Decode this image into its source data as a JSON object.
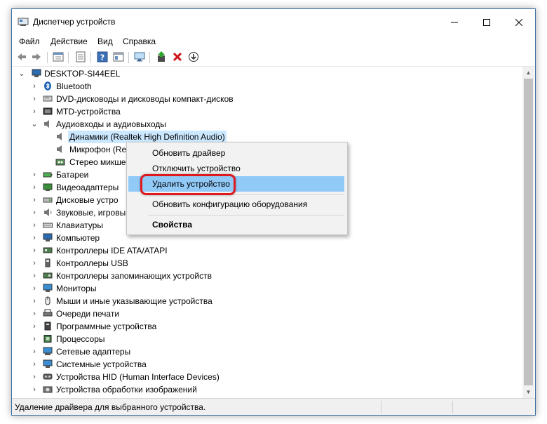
{
  "window": {
    "title": "Диспетчер устройств"
  },
  "menu": [
    "Файл",
    "Действие",
    "Вид",
    "Справка"
  ],
  "toolbar": [
    "back-icon",
    "forward-icon",
    "properties-icon",
    "devices-view-icon",
    "help-icon",
    "properties-sheet-icon",
    "monitor-scan-icon",
    "update-driver-icon",
    "remove-device-icon",
    "download-icon"
  ],
  "tree": {
    "root": "DESKTOP-SI44EEL",
    "items": [
      {
        "label": "Bluetooth",
        "icon": "bluetooth-icon"
      },
      {
        "label": "DVD-дисководы и дисководы компакт-дисков",
        "icon": "dvd-icon"
      },
      {
        "label": "MTD-устройства",
        "icon": "mtd-icon"
      },
      {
        "label": "Аудиовходы и аудиовыходы",
        "icon": "speaker-icon"
      },
      {
        "label": "Динамики (Realtek High Definition Audio)",
        "icon": "speaker-icon"
      },
      {
        "label": "Микрофон (Re",
        "icon": "speaker-icon"
      },
      {
        "label": "Стерео микше",
        "icon": "stereo-mixer-icon"
      },
      {
        "label": "Батареи",
        "icon": "battery-icon"
      },
      {
        "label": "Видеоадаптеры",
        "icon": "display-adapter-icon"
      },
      {
        "label": "Дисковые устро",
        "icon": "disk-icon"
      },
      {
        "label": "Звуковые, игровы",
        "icon": "sound-icon"
      },
      {
        "label": "Клавиатуры",
        "icon": "keyboard-icon"
      },
      {
        "label": "Компьютер",
        "icon": "computer-icon"
      },
      {
        "label": "Контроллеры IDE ATA/ATAPI",
        "icon": "ide-controller-icon"
      },
      {
        "label": "Контроллеры USB",
        "icon": "usb-icon"
      },
      {
        "label": "Контроллеры запоминающих устройств",
        "icon": "storage-controller-icon"
      },
      {
        "label": "Мониторы",
        "icon": "monitor-icon"
      },
      {
        "label": "Мыши и иные указывающие устройства",
        "icon": "mouse-icon"
      },
      {
        "label": "Очереди печати",
        "icon": "printer-icon"
      },
      {
        "label": "Программные устройства",
        "icon": "software-device-icon"
      },
      {
        "label": "Процессоры",
        "icon": "processor-icon"
      },
      {
        "label": "Сетевые адаптеры",
        "icon": "network-adapter-icon"
      },
      {
        "label": "Системные устройства",
        "icon": "system-device-icon"
      },
      {
        "label": "Устройства HID (Human Interface Devices)",
        "icon": "hid-icon"
      },
      {
        "label": "Устройства обработки изображений",
        "icon": "imaging-icon"
      }
    ]
  },
  "context_menu": {
    "items": [
      "Обновить драйвер",
      "Отключить устройство",
      "Удалить устройство",
      "Обновить конфигурацию оборудования",
      "Свойства"
    ],
    "highlighted": "Удалить устройство"
  },
  "status": {
    "text": "Удаление драйвера для выбранного устройства."
  },
  "colors": {
    "accent": "#0078d7",
    "highlight": "#91c9f7",
    "selection": "#cce8ff",
    "annotation": "#e0191e"
  }
}
